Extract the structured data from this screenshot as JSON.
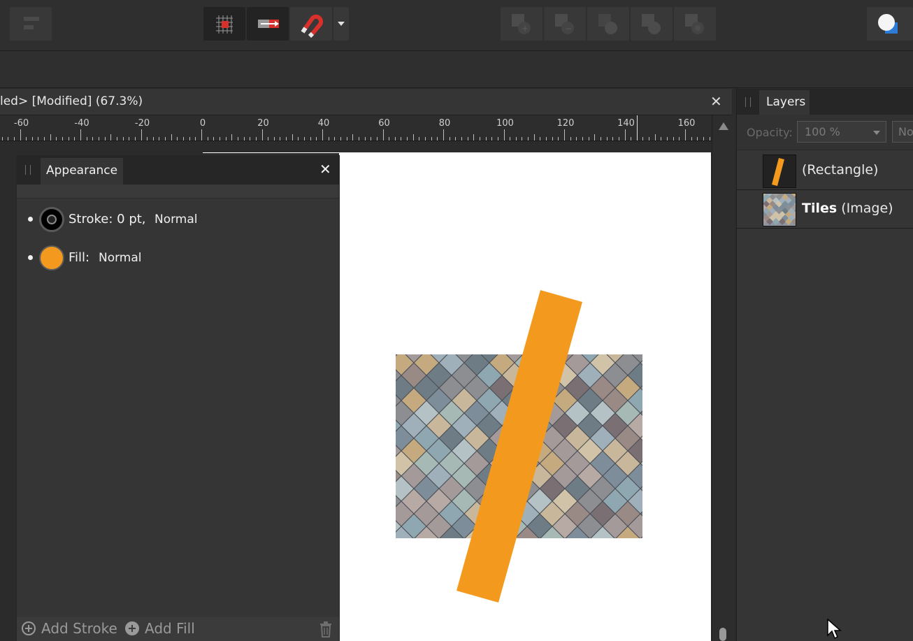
{
  "document": {
    "title": "led> [Modified] (67.3%)",
    "close_glyph": "✕"
  },
  "ruler": {
    "labels": [
      "-60",
      "-40",
      "-20",
      "0",
      "20",
      "40",
      "60",
      "80",
      "100",
      "120",
      "140",
      "160"
    ]
  },
  "appearance": {
    "tab_label": "Appearance",
    "close_glyph": "✕",
    "stroke": {
      "label": "Stroke: 0 pt,",
      "mode": "Normal",
      "color": "#000000"
    },
    "fill": {
      "label": "Fill:",
      "mode": "Normal",
      "color": "#f39a1e"
    },
    "footer": {
      "add_stroke": "Add Stroke",
      "add_fill": "Add Fill"
    }
  },
  "layers": {
    "tab_label": "Layers",
    "opacity_label": "Opacity:",
    "opacity_value": "100 %",
    "blend_value": "No",
    "items": [
      {
        "name_bold": "",
        "name_type": "(Rectangle)"
      },
      {
        "name_bold": "Tiles",
        "name_type": "(Image)"
      }
    ]
  },
  "colors": {
    "accent_orange": "#f39a1e",
    "panel_bg": "#353535"
  }
}
